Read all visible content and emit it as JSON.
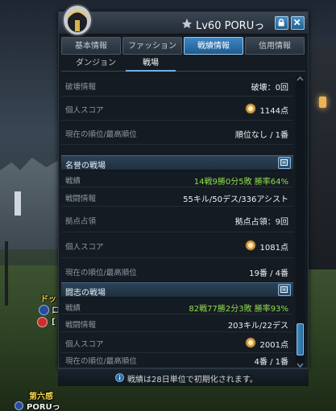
{
  "window": {
    "title": "Lv60 PORUっ",
    "tabs": [
      "基本情報",
      "ファッション",
      "戦績情報",
      "信用情報"
    ],
    "active_tab": "戦績情報",
    "subtabs": [
      "ダンジョン",
      "戦場"
    ],
    "active_subtab": "戦場"
  },
  "rows_top": [
    {
      "label": "破壊情報",
      "value": "破壊：0回"
    },
    {
      "label": "個人スコア",
      "value": "1144点"
    },
    {
      "label": "現在の順位/最高順位",
      "value": "順位なし / 1番"
    }
  ],
  "section1": {
    "title": "名誉の戦場",
    "rows": [
      {
        "label": "戦績",
        "value": "14戦9勝0分5敗 勝率64%"
      },
      {
        "label": "戦闘情報",
        "value": "55キル/50デス/336アシスト"
      },
      {
        "label": "拠点占領",
        "value": "拠点占領：9回"
      },
      {
        "label": "個人スコア",
        "value": "1081点"
      },
      {
        "label": "現在の順位/最高順位",
        "value": "19番 / 4番"
      }
    ]
  },
  "section2": {
    "title": "闘志の戦場",
    "rows": [
      {
        "label": "戦績",
        "value": "82戦77勝2分3敗 勝率93%"
      },
      {
        "label": "戦闘情報",
        "value": "203キル/22デス"
      },
      {
        "label": "個人スコア",
        "value": "2001点"
      },
      {
        "label": "現在の順位/最高順位",
        "value": "4番 / 1番"
      }
    ]
  },
  "footer": {
    "text": "戦績は28日単位で初期化されます。"
  },
  "scene": {
    "nameplate1": "ドッ",
    "nameplate2": "ロ",
    "nameplate3": "[",
    "guild": "第六感",
    "player": "PORUっ"
  },
  "colors": {
    "accent": "#3e86c4",
    "win_rate": "#8ee04a",
    "nameplate": "#f2d24a"
  }
}
